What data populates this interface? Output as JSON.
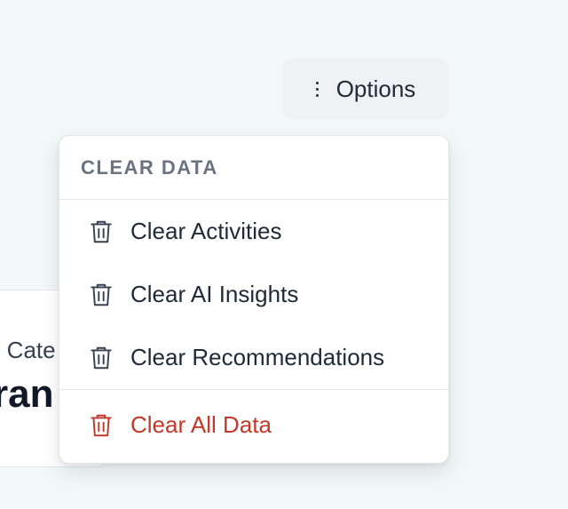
{
  "background_card": {
    "subtitle_fragment": "p Cate",
    "title_fragment": "ran"
  },
  "options_button": {
    "label": "Options",
    "icon": "vertical-dots-icon"
  },
  "menu": {
    "header": "CLEAR DATA",
    "items": [
      {
        "label": "Clear Activities",
        "icon": "trash-icon",
        "danger": false
      },
      {
        "label": "Clear AI Insights",
        "icon": "trash-icon",
        "danger": false
      },
      {
        "label": "Clear Recommendations",
        "icon": "trash-icon",
        "danger": false
      },
      {
        "label": "Clear All Data",
        "icon": "trash-icon",
        "danger": true
      }
    ]
  },
  "colors": {
    "page_background": "#f1f8f7",
    "text_primary": "#1f2937",
    "text_muted": "#6b7280",
    "danger": "#c0392b",
    "button_background": "#eef2f4"
  }
}
